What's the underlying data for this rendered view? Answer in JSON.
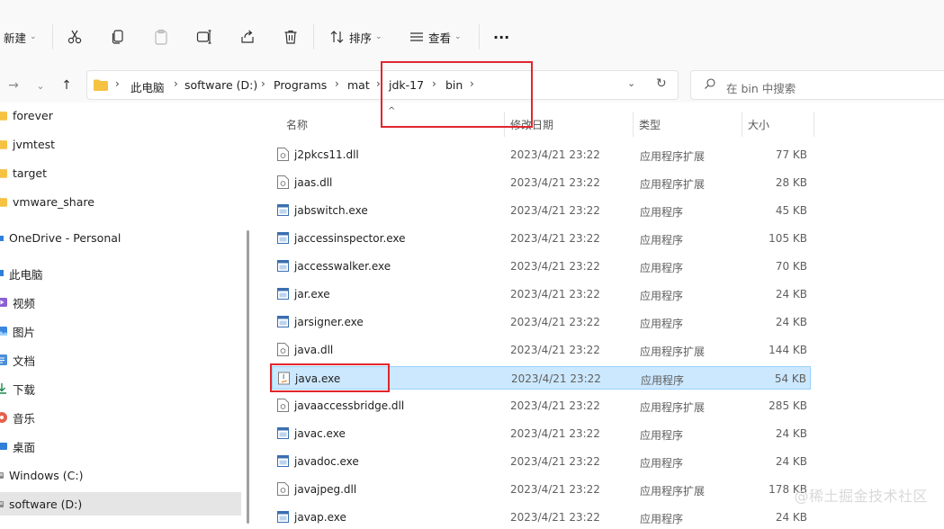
{
  "toolbar": {
    "new_label": "新建",
    "sort_label": "排序",
    "view_label": "查看",
    "more_label": "···"
  },
  "address": {
    "crumbs": [
      "此电脑",
      "software (D:)",
      "Programs",
      "mat",
      "jdk-17",
      "bin"
    ],
    "search_placeholder": "在 bin 中搜索"
  },
  "sidebar": {
    "items": [
      {
        "label": "forever",
        "icon": "folder-icon"
      },
      {
        "label": "jvmtest",
        "icon": "folder-icon"
      },
      {
        "label": "target",
        "icon": "folder-icon"
      },
      {
        "label": "vmware_share",
        "icon": "folder-icon"
      },
      {
        "label": "OneDrive - Personal",
        "icon": "cloud-icon"
      },
      {
        "label": "此电脑",
        "icon": "computer-icon"
      },
      {
        "label": "视频",
        "icon": "video-icon"
      },
      {
        "label": "图片",
        "icon": "pictures-icon"
      },
      {
        "label": "文档",
        "icon": "documents-icon"
      },
      {
        "label": "下载",
        "icon": "download-icon"
      },
      {
        "label": "音乐",
        "icon": "music-icon"
      },
      {
        "label": "桌面",
        "icon": "desktop-icon"
      },
      {
        "label": "Windows (C:)",
        "icon": "drive-icon"
      },
      {
        "label": "software (D:)",
        "icon": "drive-icon"
      }
    ],
    "selected": "software (D:)"
  },
  "columns": {
    "name": "名称",
    "date": "修改日期",
    "type": "类型",
    "size": "大小"
  },
  "files": [
    {
      "name": "j2pkcs11.dll",
      "date": "2023/4/21 23:22",
      "type": "应用程序扩展",
      "size": "77 KB",
      "icon": "dll-icon"
    },
    {
      "name": "jaas.dll",
      "date": "2023/4/21 23:22",
      "type": "应用程序扩展",
      "size": "28 KB",
      "icon": "dll-icon"
    },
    {
      "name": "jabswitch.exe",
      "date": "2023/4/21 23:22",
      "type": "应用程序",
      "size": "45 KB",
      "icon": "exe-icon"
    },
    {
      "name": "jaccessinspector.exe",
      "date": "2023/4/21 23:22",
      "type": "应用程序",
      "size": "105 KB",
      "icon": "exe-icon"
    },
    {
      "name": "jaccesswalker.exe",
      "date": "2023/4/21 23:22",
      "type": "应用程序",
      "size": "70 KB",
      "icon": "exe-icon"
    },
    {
      "name": "jar.exe",
      "date": "2023/4/21 23:22",
      "type": "应用程序",
      "size": "24 KB",
      "icon": "exe-icon"
    },
    {
      "name": "jarsigner.exe",
      "date": "2023/4/21 23:22",
      "type": "应用程序",
      "size": "24 KB",
      "icon": "exe-icon"
    },
    {
      "name": "java.dll",
      "date": "2023/4/21 23:22",
      "type": "应用程序扩展",
      "size": "144 KB",
      "icon": "dll-icon"
    },
    {
      "name": "java.exe",
      "date": "2023/4/21 23:22",
      "type": "应用程序",
      "size": "54 KB",
      "icon": "java-exe-icon",
      "selected": true
    },
    {
      "name": "javaaccessbridge.dll",
      "date": "2023/4/21 23:22",
      "type": "应用程序扩展",
      "size": "285 KB",
      "icon": "dll-icon"
    },
    {
      "name": "javac.exe",
      "date": "2023/4/21 23:22",
      "type": "应用程序",
      "size": "24 KB",
      "icon": "exe-icon"
    },
    {
      "name": "javadoc.exe",
      "date": "2023/4/21 23:22",
      "type": "应用程序",
      "size": "24 KB",
      "icon": "exe-icon"
    },
    {
      "name": "javajpeg.dll",
      "date": "2023/4/21 23:22",
      "type": "应用程序扩展",
      "size": "178 KB",
      "icon": "dll-icon"
    },
    {
      "name": "javap.exe",
      "date": "2023/4/21 23:22",
      "type": "应用程序",
      "size": "24 KB",
      "icon": "exe-icon"
    }
  ],
  "watermark": "@稀土掘金技术社区",
  "colors": {
    "selection": "#cce8ff",
    "highlight": "#e0262d",
    "folder": "#f5c242"
  }
}
